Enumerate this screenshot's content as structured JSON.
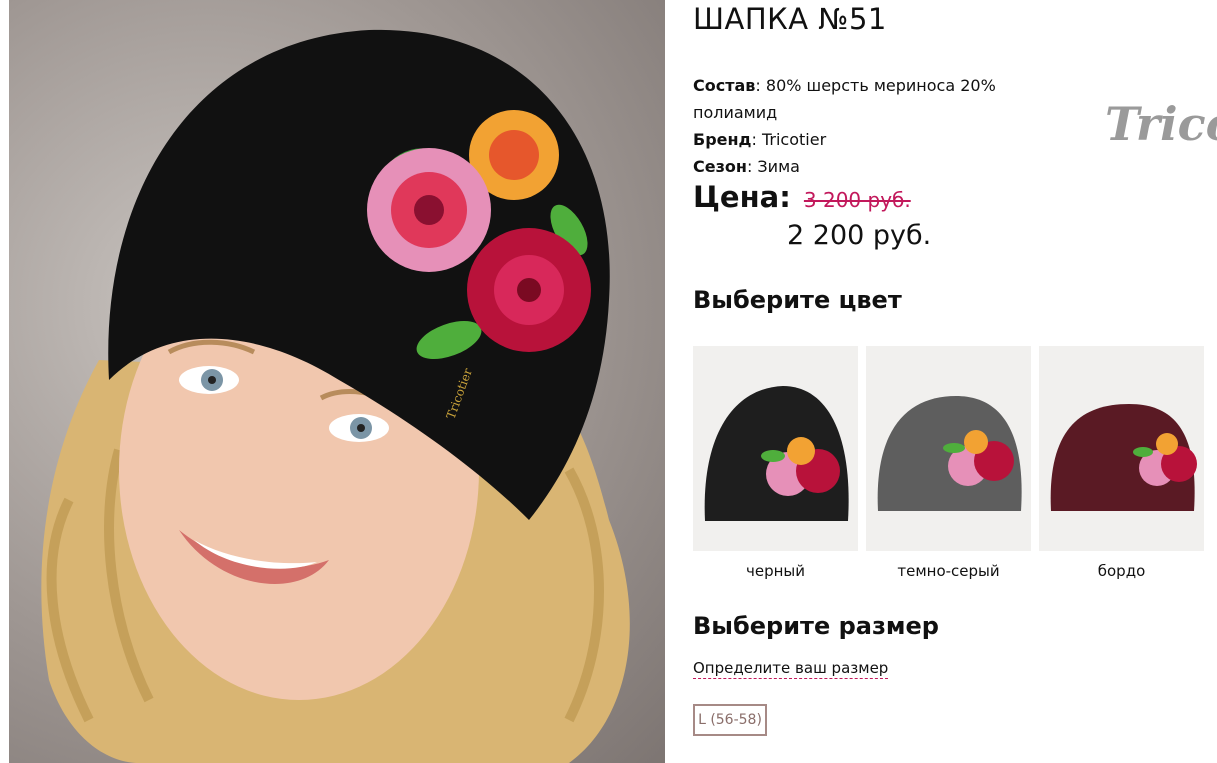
{
  "product": {
    "title": "ШАПКА №51",
    "composition_label": "Состав",
    "composition_value": "80% шерсть мериноса 20% полиамид",
    "brand_label": "Бренд",
    "brand_value": "Tricotier",
    "season_label": "Сезон",
    "season_value": "Зима",
    "price_label": "Цена",
    "price_old": "3 200 руб.",
    "price_new": "2 200 руб."
  },
  "color_section": {
    "heading": "Выберите цвет",
    "options": [
      {
        "label": "черный",
        "hat_color": "#1e1e1e"
      },
      {
        "label": "темно-серый",
        "hat_color": "#5a5a5a"
      },
      {
        "label": "бордо",
        "hat_color": "#5a1a24"
      }
    ]
  },
  "size_section": {
    "heading": "Выберите размер",
    "guide_link": "Определите ваш размер",
    "sizes": [
      "L (56-58)"
    ]
  },
  "logo_text": "Trico",
  "colors": {
    "accent": "#c2185b",
    "size_border": "#a68a86"
  }
}
